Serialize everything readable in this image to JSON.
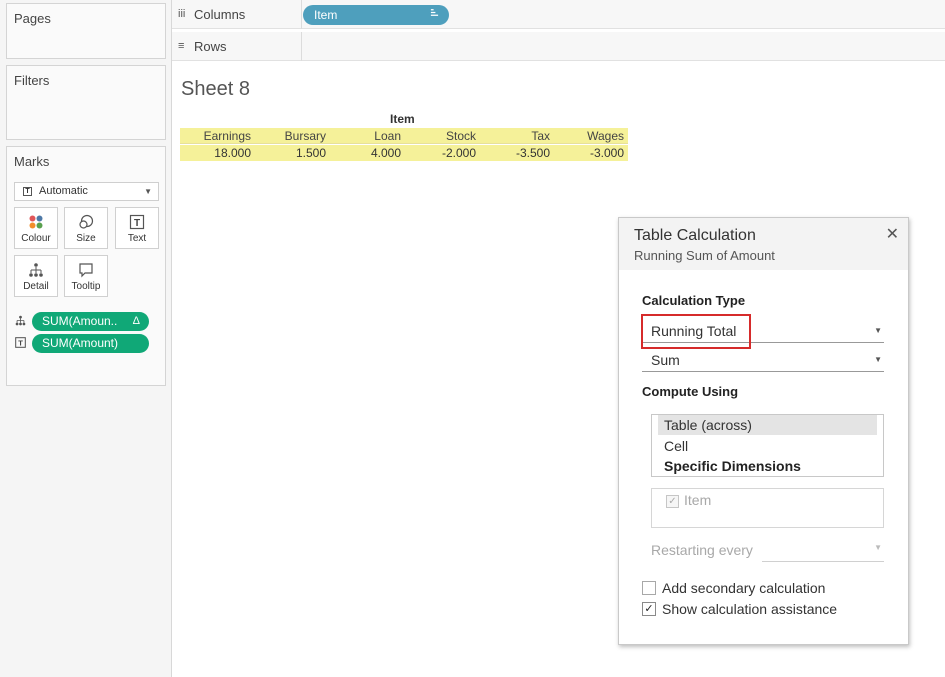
{
  "shelves": {
    "pages_label": "Pages",
    "columns_label": "Columns",
    "columns_icon": "iii",
    "rows_label": "Rows",
    "rows_icon": "≡",
    "column_pill": "Item",
    "column_pill_icon": "sort-icon"
  },
  "filters": {
    "label": "Filters"
  },
  "marks": {
    "label": "Marks",
    "mark_type": "Automatic",
    "buttons": [
      {
        "label": "Colour",
        "icon": "colour-icon"
      },
      {
        "label": "Size",
        "icon": "size-icon"
      },
      {
        "label": "Text",
        "icon": "text-icon"
      },
      {
        "label": "Detail",
        "icon": "detail-icon"
      },
      {
        "label": "Tooltip",
        "icon": "tooltip-icon"
      }
    ],
    "pills": [
      {
        "label": "SUM(Amoun..",
        "badge": "Δ",
        "icon": "detail-icon",
        "color": "#10a877"
      },
      {
        "label": "SUM(Amount)",
        "icon": "text-icon",
        "color": "#10a877"
      }
    ]
  },
  "sheet": {
    "title": "Sheet 8",
    "header": "Item",
    "columns": [
      "Earnings",
      "Bursary",
      "Loan",
      "Stock",
      "Tax",
      "Wages"
    ],
    "values": [
      "18.000",
      "1.500",
      "4.000",
      "-2.000",
      "-3.500",
      "-3.000"
    ],
    "highlight_color": "#f5f199"
  },
  "dialog": {
    "title": "Table Calculation",
    "subtitle": "Running Sum of Amount",
    "close": "✕",
    "calc_type_label": "Calculation Type",
    "calc_type_value": "Running Total",
    "aggregation_value": "Sum",
    "compute_using_label": "Compute Using",
    "compute_options": [
      "Table (across)",
      "Cell",
      "Specific Dimensions"
    ],
    "selected_option": "Table (across)",
    "dimension_item": "Item",
    "dimension_checked": true,
    "restarting_label": "Restarting every",
    "secondary_calc_label": "Add secondary calculation",
    "secondary_calc_checked": false,
    "assistance_label": "Show calculation assistance",
    "assistance_checked": true,
    "check_mark": "✓",
    "highlight_color": "#d62b2b"
  }
}
